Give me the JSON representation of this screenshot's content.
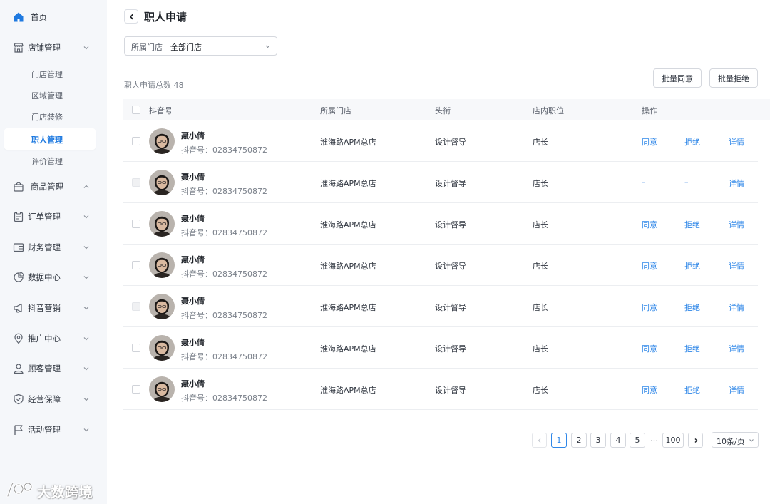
{
  "sidebar": {
    "items": [
      {
        "label": "首页",
        "icon": "home-icon"
      },
      {
        "label": "店铺管理",
        "icon": "store-icon"
      },
      {
        "label": "商品管理",
        "icon": "shopping-bag-icon"
      },
      {
        "label": "订单管理",
        "icon": "clipboard-icon"
      },
      {
        "label": "财务管理",
        "icon": "wallet-icon"
      },
      {
        "label": "数据中心",
        "icon": "pie-chart-icon"
      },
      {
        "label": "抖音营销",
        "icon": "megaphone-icon"
      },
      {
        "label": "推广中心",
        "icon": "location-pin-icon"
      },
      {
        "label": "顾客管理",
        "icon": "user-icon"
      },
      {
        "label": "经营保障",
        "icon": "shield-icon"
      },
      {
        "label": "活动管理",
        "icon": "flag-icon"
      }
    ],
    "store_sub": [
      "门店管理",
      "区域管理",
      "门店装修",
      "职人管理",
      "评价管理"
    ],
    "active_sub": "职人管理"
  },
  "watermark": {
    "text": "大数跨境"
  },
  "header": {
    "title": "职人申请"
  },
  "filter": {
    "label": "所属门店",
    "value": "全部门店"
  },
  "summary": {
    "total_label": "职人申请总数 48"
  },
  "actions": {
    "approve_all": "批量同意",
    "reject_all": "批量拒绝"
  },
  "table": {
    "columns": [
      "抖音号",
      "所属门店",
      "头衔",
      "店内职位",
      "操作"
    ],
    "id_label": "抖音号：",
    "rows": [
      {
        "name": "聂小倩",
        "douyin_id": "02834750872",
        "store": "淮海路APM总店",
        "title": "设计督导",
        "position": "店长",
        "approve": "同意",
        "reject": "拒绝",
        "detail": "详情",
        "checkbox_disabled": false
      },
      {
        "name": "聂小倩",
        "douyin_id": "02834750872",
        "store": "淮海路APM总店",
        "title": "设计督导",
        "position": "店长",
        "approve": "–",
        "reject": "–",
        "detail": "详情",
        "checkbox_disabled": true
      },
      {
        "name": "聂小倩",
        "douyin_id": "02834750872",
        "store": "淮海路APM总店",
        "title": "设计督导",
        "position": "店长",
        "approve": "同意",
        "reject": "拒绝",
        "detail": "详情",
        "checkbox_disabled": false
      },
      {
        "name": "聂小倩",
        "douyin_id": "02834750872",
        "store": "淮海路APM总店",
        "title": "设计督导",
        "position": "店长",
        "approve": "同意",
        "reject": "拒绝",
        "detail": "详情",
        "checkbox_disabled": false
      },
      {
        "name": "聂小倩",
        "douyin_id": "02834750872",
        "store": "淮海路APM总店",
        "title": "设计督导",
        "position": "店长",
        "approve": "同意",
        "reject": "拒绝",
        "detail": "详情",
        "checkbox_disabled": true
      },
      {
        "name": "聂小倩",
        "douyin_id": "02834750872",
        "store": "淮海路APM总店",
        "title": "设计督导",
        "position": "店长",
        "approve": "同意",
        "reject": "拒绝",
        "detail": "详情",
        "checkbox_disabled": false
      },
      {
        "name": "聂小倩",
        "douyin_id": "02834750872",
        "store": "淮海路APM总店",
        "title": "设计督导",
        "position": "店长",
        "approve": "同意",
        "reject": "拒绝",
        "detail": "详情",
        "checkbox_disabled": false
      }
    ]
  },
  "pagination": {
    "pages": [
      "1",
      "2",
      "3",
      "4",
      "5"
    ],
    "current": "1",
    "ellipsis": "…",
    "last": "100",
    "page_size": "10条/页"
  },
  "colors": {
    "accent": "#2f87e8",
    "sidebar_bg": "#f5f7fa",
    "home_icon": "#1f7ae0"
  }
}
